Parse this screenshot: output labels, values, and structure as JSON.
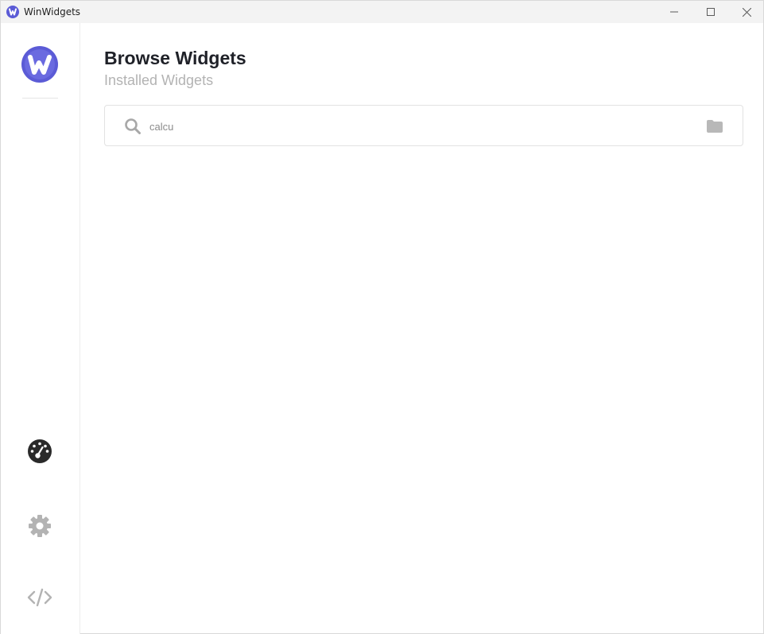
{
  "window": {
    "title": "WinWidgets"
  },
  "sidebar": {
    "items": [
      {
        "name": "dashboard",
        "icon": "dashboard-gauge-icon"
      },
      {
        "name": "settings",
        "icon": "gear-icon"
      },
      {
        "name": "developer",
        "icon": "code-icon"
      }
    ]
  },
  "main": {
    "title": "Browse Widgets",
    "subtitle": "Installed Widgets",
    "search": {
      "value": "calcu",
      "placeholder": ""
    }
  },
  "colors": {
    "brand": "#5b5bd6",
    "icon_gray": "#b3b3b3",
    "icon_dark": "#2a2a2a"
  }
}
